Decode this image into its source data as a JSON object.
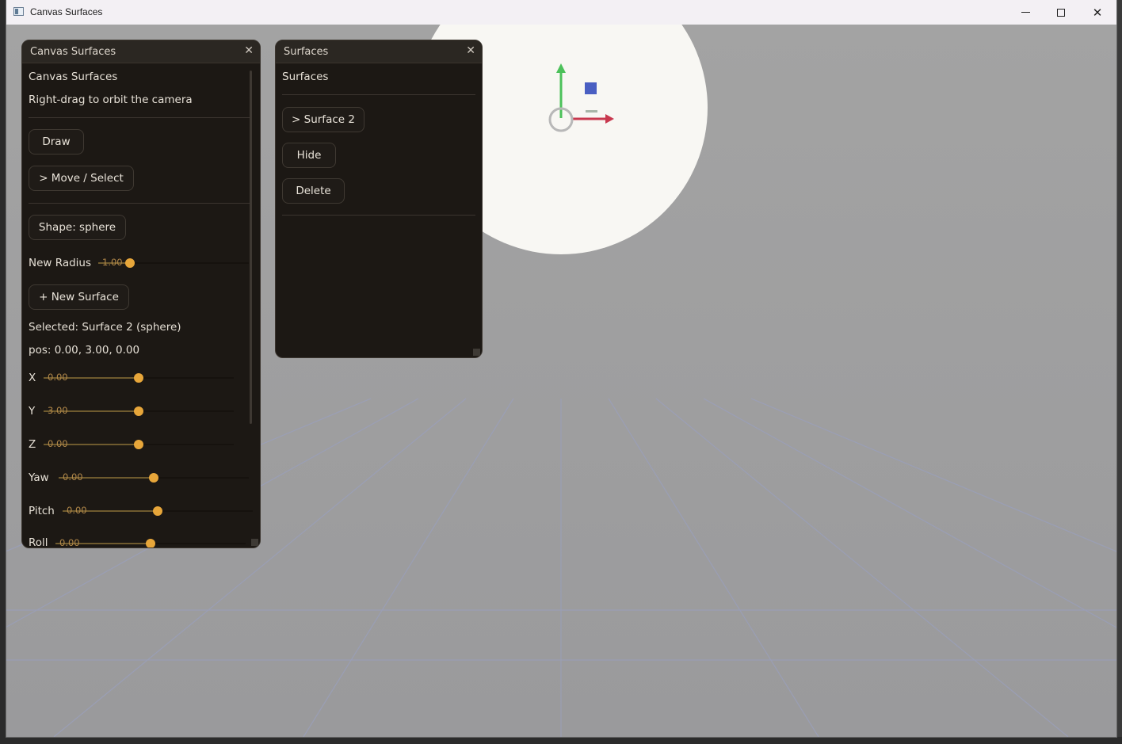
{
  "window": {
    "title": "Canvas Surfaces"
  },
  "controls_panel": {
    "header": "Canvas Surfaces",
    "heading": "Canvas Surfaces",
    "hint": "Right-drag to orbit the camera",
    "draw_label": "Draw",
    "move_select_label": "> Move / Select",
    "shape_label": "Shape: sphere",
    "new_radius": {
      "label": "New Radius",
      "value": "1.00"
    },
    "new_surface_label": "+ New Surface",
    "selected_text": "Selected: Surface 2 (sphere)",
    "pos_text": "pos: 0.00, 3.00, 0.00",
    "sliders": [
      {
        "label": "X",
        "value": "0.00"
      },
      {
        "label": "Y",
        "value": "3.00"
      },
      {
        "label": "Z",
        "value": "0.00"
      },
      {
        "label": "Yaw",
        "value": "0.00"
      },
      {
        "label": "Pitch",
        "value": "0.00"
      },
      {
        "label": "Roll",
        "value": "0.00"
      }
    ]
  },
  "surfaces_panel": {
    "header": "Surfaces",
    "heading": "Surfaces",
    "surface_item_label": "> Surface 2",
    "hide_label": "Hide",
    "delete_label": "Delete"
  },
  "colors": {
    "panel_bg": "#1c1814",
    "accent": "#e7a63a",
    "sphere": "#f8f7f3",
    "gizmo_y": "#4cc15a",
    "gizmo_x": "#c8384e",
    "gizmo_z": "#4a5fc2"
  }
}
